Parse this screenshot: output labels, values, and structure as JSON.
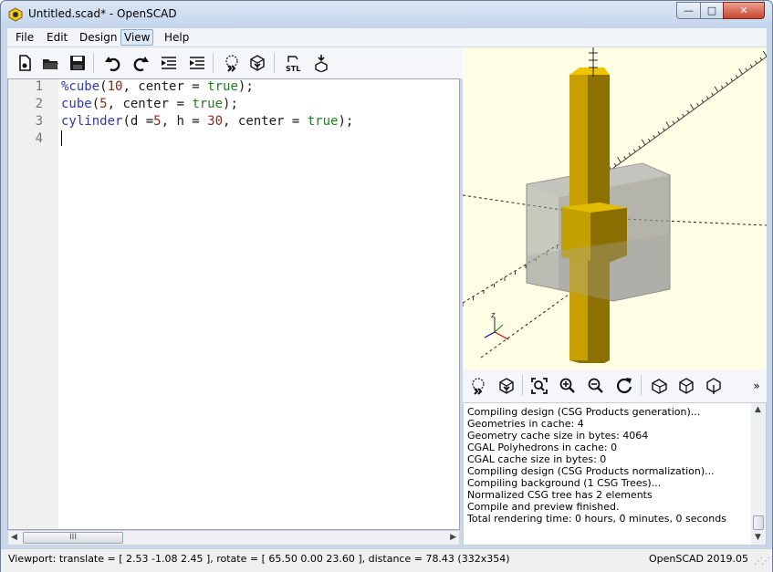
{
  "window": {
    "title": "Untitled.scad* - OpenSCAD",
    "min_symbol": "—",
    "max_symbol": "□",
    "close_symbol": "✕"
  },
  "menu": [
    "File",
    "Edit",
    "Design",
    "View",
    "Help"
  ],
  "menu_active": "View",
  "toolbar_left": [
    "new-file-icon",
    "open-file-icon",
    "save-icon",
    "undo-icon",
    "redo-icon",
    "unindent-icon",
    "indent-icon",
    "preview-icon",
    "render-icon",
    "export-stl-icon",
    "send-to-print-icon"
  ],
  "toolbar_right": [
    "preview-icon",
    "render-icon",
    "view-all-icon",
    "zoom-in-icon",
    "zoom-out-icon",
    "reset-view-icon",
    "perspective-icon",
    "orthogonal-icon",
    "show-axes-icon",
    "more-icon"
  ],
  "toolbar_right_more_symbol": "»",
  "editor": {
    "line_numbers": [
      "1",
      "2",
      "3",
      "4"
    ],
    "lines": [
      [
        {
          "t": "%cube",
          "c": "kw"
        },
        {
          "t": "(",
          "c": ""
        },
        {
          "t": "10",
          "c": "num"
        },
        {
          "t": ", center = ",
          "c": ""
        },
        {
          "t": "true",
          "c": "bool"
        },
        {
          "t": ");",
          "c": ""
        }
      ],
      [
        {
          "t": "cube",
          "c": "kw"
        },
        {
          "t": "(",
          "c": ""
        },
        {
          "t": "5",
          "c": "num"
        },
        {
          "t": ", center = ",
          "c": ""
        },
        {
          "t": "true",
          "c": "bool"
        },
        {
          "t": ");",
          "c": ""
        }
      ],
      [
        {
          "t": "cylinder",
          "c": "kw"
        },
        {
          "t": "(d =",
          "c": ""
        },
        {
          "t": "5",
          "c": "num"
        },
        {
          "t": ", h = ",
          "c": ""
        },
        {
          "t": "30",
          "c": "num"
        },
        {
          "t": ", center = ",
          "c": ""
        },
        {
          "t": "true",
          "c": "bool"
        },
        {
          "t": ");",
          "c": ""
        }
      ],
      []
    ],
    "hscroll_thumb_label": "III",
    "hscroll_left": "◀",
    "hscroll_right": "▶"
  },
  "console": {
    "lines": [
      "Compiling design (CSG Products generation)...",
      "Geometries in cache: 4",
      "Geometry cache size in bytes: 4064",
      "CGAL Polyhedrons in cache: 0",
      "CGAL cache size in bytes: 0",
      "Compiling design (CSG Products normalization)...",
      "Compiling background (1 CSG Trees)...",
      "Normalized CSG tree has 2 elements",
      "Compile and preview finished.",
      "Total rendering time: 0 hours, 0 minutes, 0 seconds"
    ],
    "vscroll_up": "▲",
    "vscroll_down": "▼"
  },
  "status": {
    "viewport": "Viewport: translate = [ 2.53 -1.08 2.45 ], rotate = [ 65.50 0.00 23.60 ], distance = 78.43 (332x354)",
    "version": "OpenSCAD 2019.05"
  },
  "colors": {
    "viewport_bg": "#ffffe5",
    "object_yellow": "#e0b400",
    "ghost_gray": "#a8a8a8"
  },
  "axis_label_z": "z"
}
